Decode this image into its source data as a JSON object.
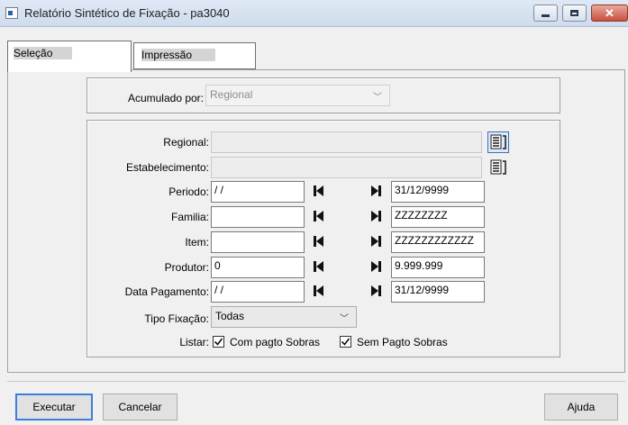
{
  "window": {
    "title": "Relatório Sintético de Fixação - pa3040"
  },
  "tabs": [
    {
      "label": "Seleção"
    },
    {
      "label": "Impressão"
    }
  ],
  "acumulado": {
    "label": "Acumulado por:",
    "value": "Regional"
  },
  "form": {
    "regional": {
      "label": "Regional:",
      "value": ""
    },
    "estabelecimento": {
      "label": "Estabelecimento:",
      "value": ""
    },
    "periodo": {
      "label": "Periodo:",
      "from": " /  /",
      "to": "31/12/9999"
    },
    "familia": {
      "label": "Familia:",
      "from": "",
      "to": "ZZZZZZZZ"
    },
    "item": {
      "label": "Item:",
      "from": "",
      "to": "ZZZZZZZZZZZZ"
    },
    "produtor": {
      "label": "Produtor:",
      "from": "0",
      "to": "9.999.999"
    },
    "data_pagamento": {
      "label": "Data Pagamento:",
      "from": " /  /",
      "to": "31/12/9999"
    },
    "tipo_fixacao": {
      "label": "Tipo Fixação:",
      "value": "Todas"
    },
    "listar": {
      "label": "Listar:",
      "options": [
        {
          "label": "Com pagto Sobras",
          "checked": true
        },
        {
          "label": "Sem Pagto Sobras",
          "checked": true
        }
      ]
    }
  },
  "buttons": {
    "executar": "Executar",
    "cancelar": "Cancelar",
    "ajuda": "Ajuda"
  }
}
